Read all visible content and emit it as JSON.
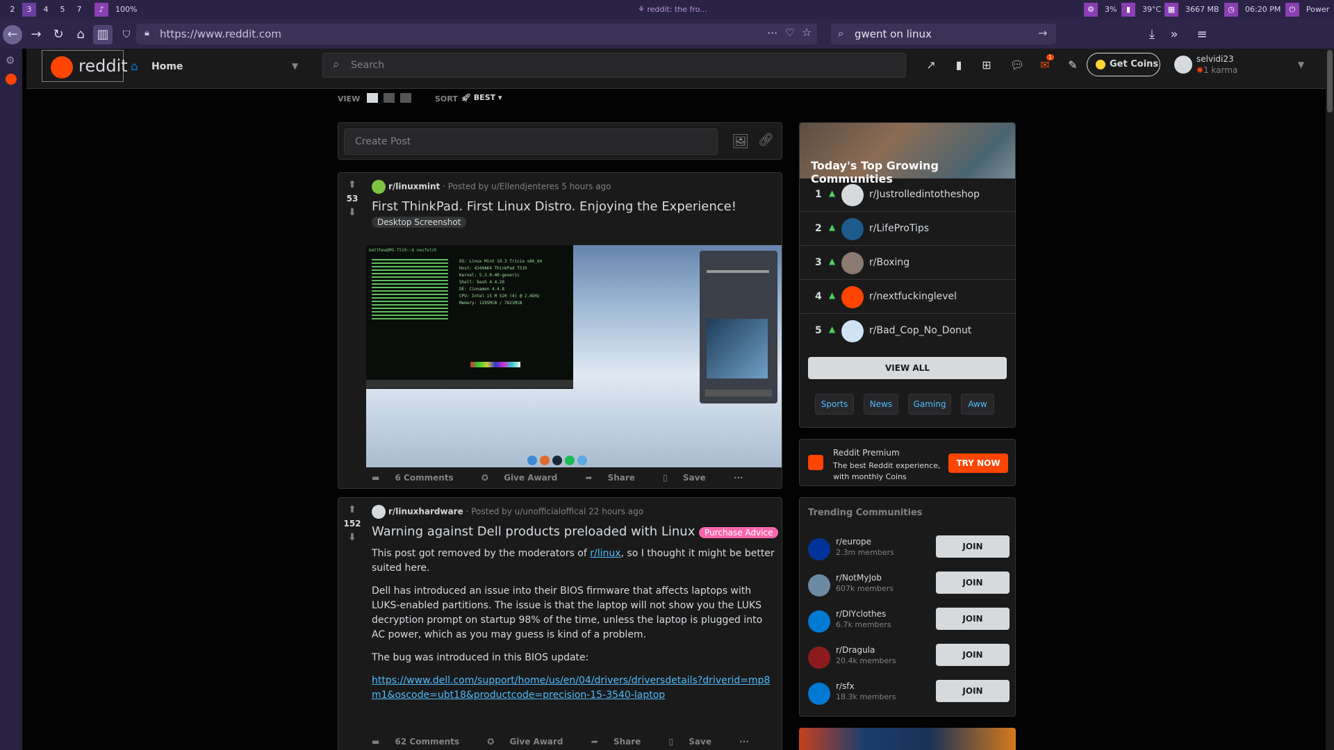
{
  "sysbar": {
    "workspaces": [
      "2",
      "3",
      "4",
      "5",
      "7"
    ],
    "volume": "100%",
    "window_title": "reddit: the fro...",
    "cpu": "3%",
    "temp": "39°C",
    "mem": "3667 MB",
    "time": "06:20 PM",
    "power": "Power"
  },
  "browser": {
    "url": "https://www.reddit.com",
    "search_value": "gwent on linux"
  },
  "header": {
    "logo_text": "reddit",
    "home_label": "Home",
    "search_placeholder": "Search",
    "coins_label": "Get Coins",
    "username": "selvidi23",
    "karma": "1 karma",
    "notification_count": "1"
  },
  "sortbar": {
    "view_label": "VIEW",
    "sort_label": "SORT",
    "sort_value": "BEST"
  },
  "createpost": {
    "placeholder": "Create Post"
  },
  "posts": [
    {
      "votes": "53",
      "subreddit": "r/linuxmint",
      "posted_by": "· Posted by u/Ellendjenteres 5 hours ago",
      "title": "First ThinkPad. First Linux Distro. Enjoying the Experience!",
      "flair": "Desktop Screenshot",
      "comments": "6 Comments",
      "award": "Give Award",
      "share": "Share",
      "save": "Save"
    },
    {
      "votes": "152",
      "subreddit": "r/linuxhardware",
      "posted_by": "· Posted by u/unofficialoffical 22 hours ago",
      "title": "Warning against Dell products preloaded with Linux",
      "flair": "Purchase Advice",
      "body_p1_a": "This post got removed by the moderators of ",
      "body_p1_link": "r/linux",
      "body_p1_b": ", so I thought it might be better suited here.",
      "body_p2": "Dell has introduced an issue into their BIOS firmware that affects laptops with LUKS-enabled partitions. The issue is that the laptop will not show you the LUKS decryption prompt on startup 98% of the time, unless the laptop is plugged into AC power, which as you may guess is kind of a problem.",
      "body_p3": "The bug was introduced in this BIOS update:",
      "body_link": "https://www.dell.com/support/home/us/en/04/drivers/driversdetails?driverid=mp8m1&oscode=ubt18&productcode=precision-15-3540-laptop",
      "comments": "62 Comments",
      "award": "Give Award",
      "share": "Share",
      "save": "Save"
    }
  ],
  "growing": {
    "title": "Today's Top Growing Communities",
    "items": [
      {
        "rank": "1",
        "name": "r/Justrolledintotheshop"
      },
      {
        "rank": "2",
        "name": "r/LifeProTips"
      },
      {
        "rank": "3",
        "name": "r/Boxing"
      },
      {
        "rank": "4",
        "name": "r/nextfuckinglevel"
      },
      {
        "rank": "5",
        "name": "r/Bad_Cop_No_Donut"
      }
    ],
    "view_all": "VIEW ALL",
    "chips": [
      "Sports",
      "News",
      "Gaming",
      "Aww"
    ]
  },
  "premium": {
    "title": "Reddit Premium",
    "desc": "The best Reddit experience, with monthly Coins",
    "button": "TRY NOW"
  },
  "trending": {
    "title": "Trending Communities",
    "items": [
      {
        "name": "r/europe",
        "members": "2.3m members"
      },
      {
        "name": "r/NotMyJob",
        "members": "607k members"
      },
      {
        "name": "r/DIYclothes",
        "members": "6.7k members"
      },
      {
        "name": "r/Dragula",
        "members": "20.4k members"
      },
      {
        "name": "r/sfx",
        "members": "18.3k members"
      }
    ],
    "join_label": "JOIN"
  },
  "icons": {
    "back": "arrow-left-icon",
    "forward": "arrow-right-icon",
    "reload": "reload-icon",
    "home": "home-icon"
  }
}
